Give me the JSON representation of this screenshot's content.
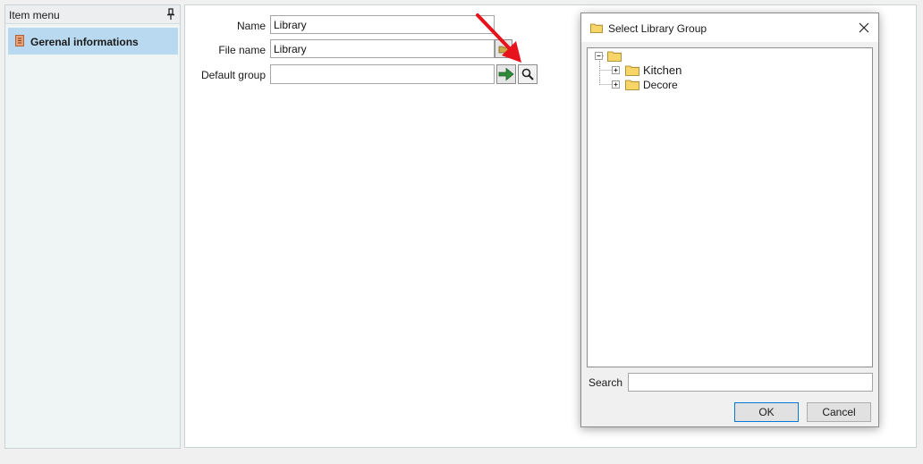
{
  "left_panel": {
    "header_title": "Item menu",
    "items": [
      {
        "label": "Gerenal informations"
      }
    ]
  },
  "form": {
    "name": {
      "label": "Name",
      "value": "Library"
    },
    "file_name": {
      "label": "File name",
      "value": "Library"
    },
    "default_group": {
      "label": "Default group",
      "value": ""
    }
  },
  "dialog": {
    "title": "Select Library Group",
    "tree": {
      "root_label": "",
      "children": [
        {
          "label": "Kitchen"
        },
        {
          "label": "Decore"
        }
      ]
    },
    "search_label": "Search",
    "search_value": "",
    "ok_label": "OK",
    "cancel_label": "Cancel"
  },
  "colors": {
    "selection": "#b8d9ef",
    "folder": "#f7d567",
    "arrow_green": "#2e8b3a",
    "annotation_red": "#e8121c",
    "ok_border": "#0078d7"
  }
}
